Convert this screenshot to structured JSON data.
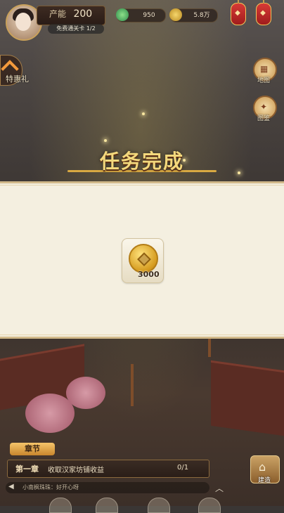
{
  "hud": {
    "production_label": "产能",
    "production_value": "200",
    "pass_chip": "免费通关卡 1/2",
    "jade": "950",
    "gold": "5.8万",
    "left_tab": "特惠礼",
    "right_buttons": [
      "地图",
      "图鉴"
    ]
  },
  "title": "任务完成",
  "reward": {
    "icon": "copper-coin-icon",
    "amount": "3000"
  },
  "quest": {
    "tab": "章节",
    "chapter": "第一章",
    "text": "收取汉家坊铺收益",
    "progress": "0/1"
  },
  "build_button": "建造",
  "chat": "小南枫珠珠：好开心呀",
  "colors": {
    "accent_gold": "#d9a942",
    "panel_bg": "#f4efe0",
    "title": "#f3d87c"
  }
}
